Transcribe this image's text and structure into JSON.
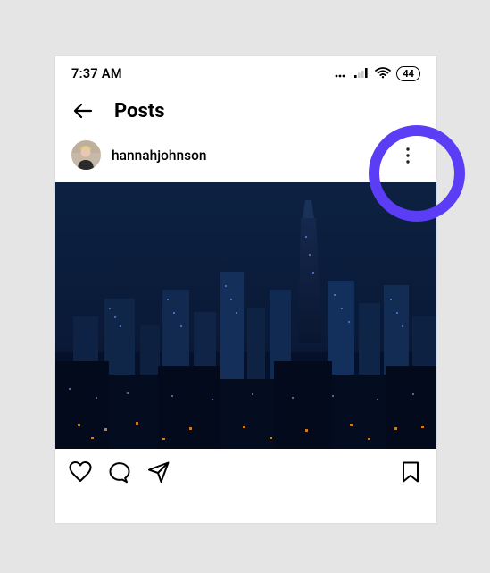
{
  "status": {
    "time": "7:37 AM",
    "battery": "44"
  },
  "header": {
    "title": "Posts"
  },
  "post": {
    "username": "hannahjohnson"
  }
}
